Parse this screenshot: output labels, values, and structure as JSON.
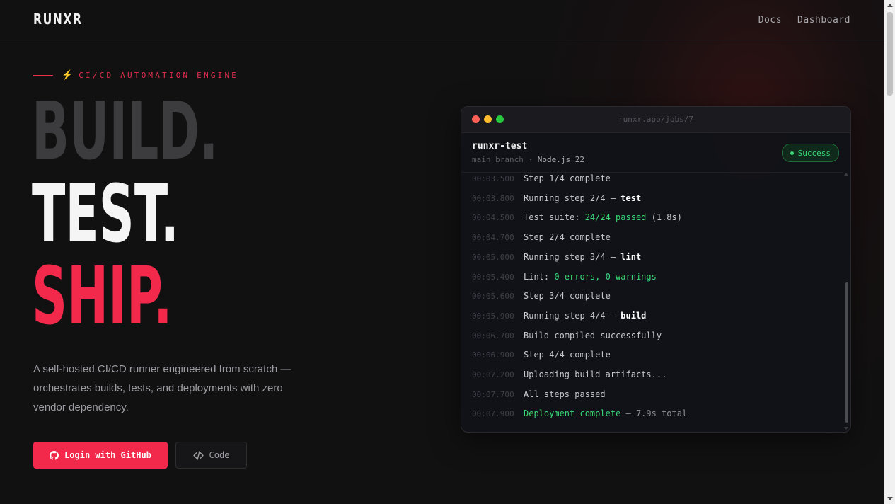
{
  "brand": {
    "logo": "RUNXR"
  },
  "nav": {
    "docs": "Docs",
    "dashboard": "Dashboard"
  },
  "hero": {
    "eyebrow": "CI/CD AUTOMATION ENGINE",
    "line1": "BUILD.",
    "line2": "TEST.",
    "line3": "SHIP.",
    "description": "A self-hosted CI/CD runner engineered from scratch — orchestrates builds, tests, and deployments with zero vendor dependency.",
    "primary_button": "Login with GitHub",
    "secondary_button": "Code"
  },
  "terminal": {
    "url": "runxr.app/jobs/7",
    "job_name": "runxr-test",
    "branch": "main branch",
    "separator": "·",
    "runtime": "Node.js 22",
    "status": "Success",
    "logs": [
      {
        "ts": "00:03.500",
        "text": "Step 1/4 complete"
      },
      {
        "ts": "00:03.800",
        "text": "Running step 2/4 — ",
        "strong": "test"
      },
      {
        "ts": "00:04.500",
        "text": "Test suite: ",
        "green": "24/24 passed",
        "tail": " (1.8s)"
      },
      {
        "ts": "00:04.700",
        "text": "Step 2/4 complete"
      },
      {
        "ts": "00:05.000",
        "text": "Running step 3/4 — ",
        "strong": "lint"
      },
      {
        "ts": "00:05.400",
        "text": "Lint: ",
        "green": "0 errors, 0 warnings"
      },
      {
        "ts": "00:05.600",
        "text": "Step 3/4 complete"
      },
      {
        "ts": "00:05.900",
        "text": "Running step 4/4 — ",
        "strong": "build"
      },
      {
        "ts": "00:06.700",
        "text": "Build compiled successfully"
      },
      {
        "ts": "00:06.900",
        "text": "Step 4/4 complete"
      },
      {
        "ts": "00:07.200",
        "text": "Uploading build artifacts..."
      },
      {
        "ts": "00:07.700",
        "text": "All steps passed"
      },
      {
        "ts": "00:07.900",
        "green_first": "Deployment complete",
        "dim_tail": " — 7.9s total"
      }
    ]
  },
  "colors": {
    "accent": "#f2294a",
    "success": "#39d875",
    "background": "#111112"
  }
}
